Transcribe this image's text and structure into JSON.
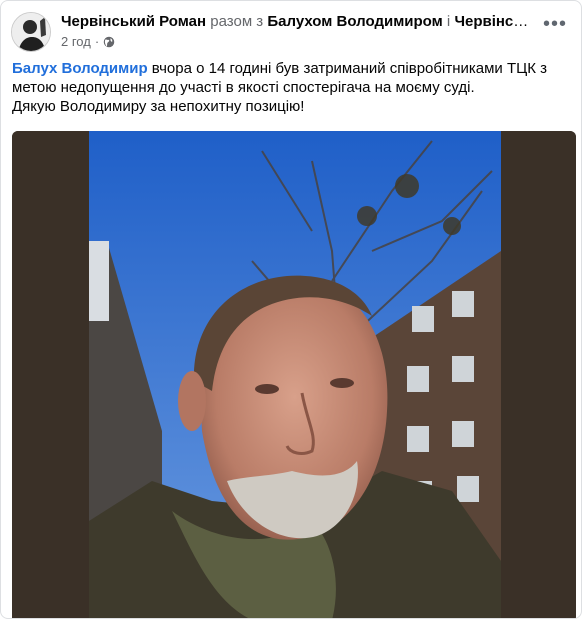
{
  "post": {
    "author": "Червінський Роман",
    "connector_1": "разом з",
    "tagged_1": "Балухом Володимиром",
    "connector_2": "і",
    "tagged_2": "Червінською…",
    "time": "2 год",
    "dot": "·",
    "privacy_icon": "globe-icon",
    "more_label": "•••",
    "text": {
      "mention": "Балух Володимир",
      "line1_rest": " вчора о 14 годині був затриманий співробітниками ТЦК з",
      "line2": "метою недопущення до участі в якості спостерігача на моєму суді.",
      "line3": "Дякую Володимиру за непохитну позицію!"
    }
  }
}
